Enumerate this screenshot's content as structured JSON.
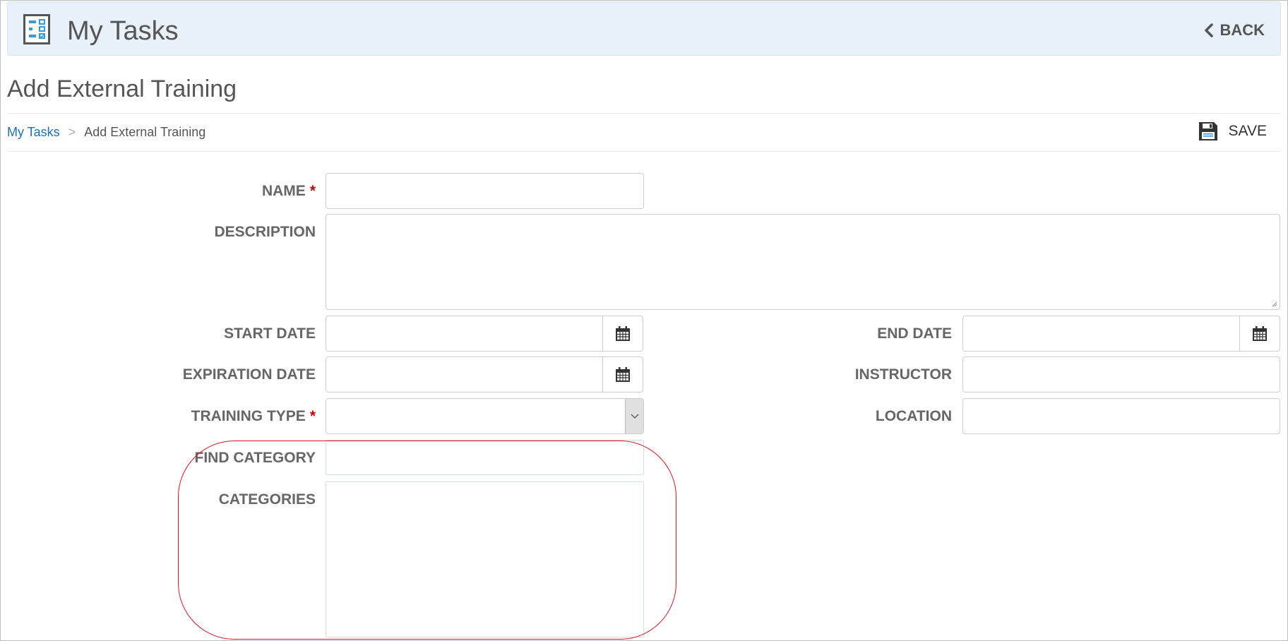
{
  "header": {
    "app_title": "My Tasks",
    "app_icon": "task-list-icon",
    "back_label": "BACK"
  },
  "page": {
    "title": "Add External Training"
  },
  "breadcrumb": {
    "root": "My Tasks",
    "separator": ">",
    "current": "Add External Training"
  },
  "toolbar": {
    "save_label": "SAVE",
    "save_icon": "floppy-disk-icon"
  },
  "form": {
    "name_label": "NAME",
    "description_label": "DESCRIPTION",
    "start_date_label": "START DATE",
    "end_date_label": "END DATE",
    "expiration_date_label": "EXPIRATION DATE",
    "instructor_label": "INSTRUCTOR",
    "training_type_label": "TRAINING TYPE",
    "location_label": "LOCATION",
    "find_category_label": "FIND CATEGORY",
    "categories_label": "CATEGORIES",
    "required_marker": "*",
    "name_value": "",
    "description_value": "",
    "start_date_value": "",
    "end_date_value": "",
    "expiration_date_value": "",
    "instructor_value": "",
    "training_type_value": "",
    "location_value": "",
    "find_category_value": ""
  },
  "colors": {
    "header_bg": "#e8f0f9",
    "link": "#1f6fb5",
    "required": "#cc0000",
    "highlight": "#e0141e"
  }
}
